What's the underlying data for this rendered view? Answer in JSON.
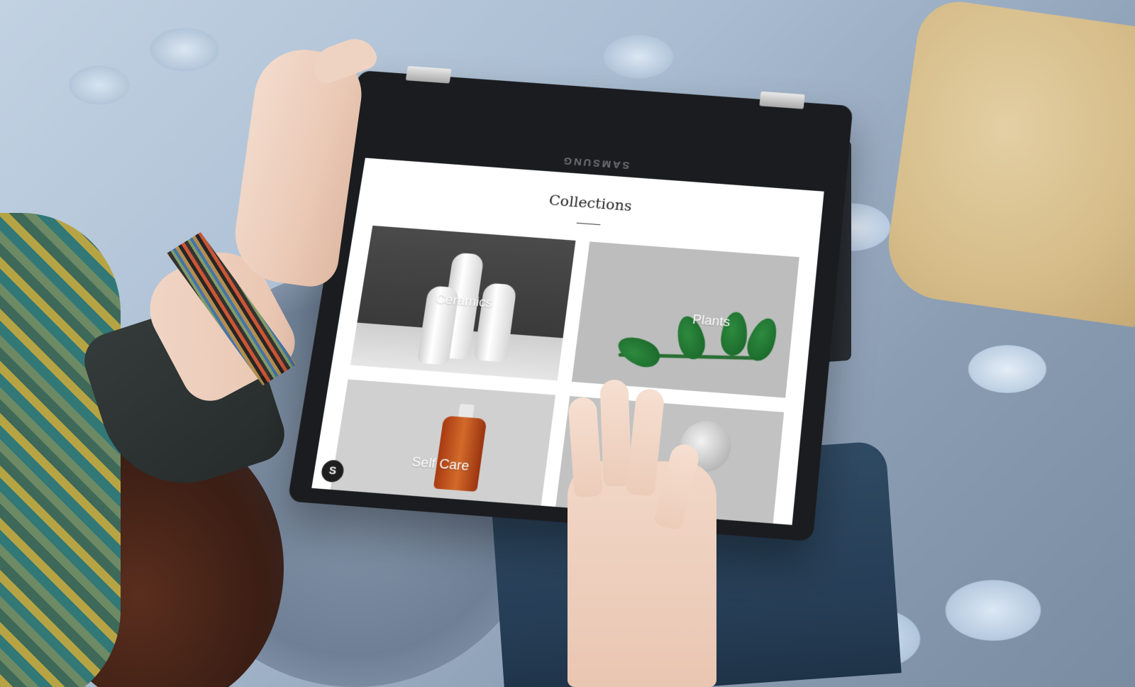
{
  "device": {
    "brand": "SAMSUNG"
  },
  "screen": {
    "title": "Collections",
    "collections": [
      {
        "label": "Ceramics"
      },
      {
        "label": "Plants"
      },
      {
        "label": "Self Care"
      },
      {
        "label": ""
      }
    ],
    "badge": "S"
  }
}
